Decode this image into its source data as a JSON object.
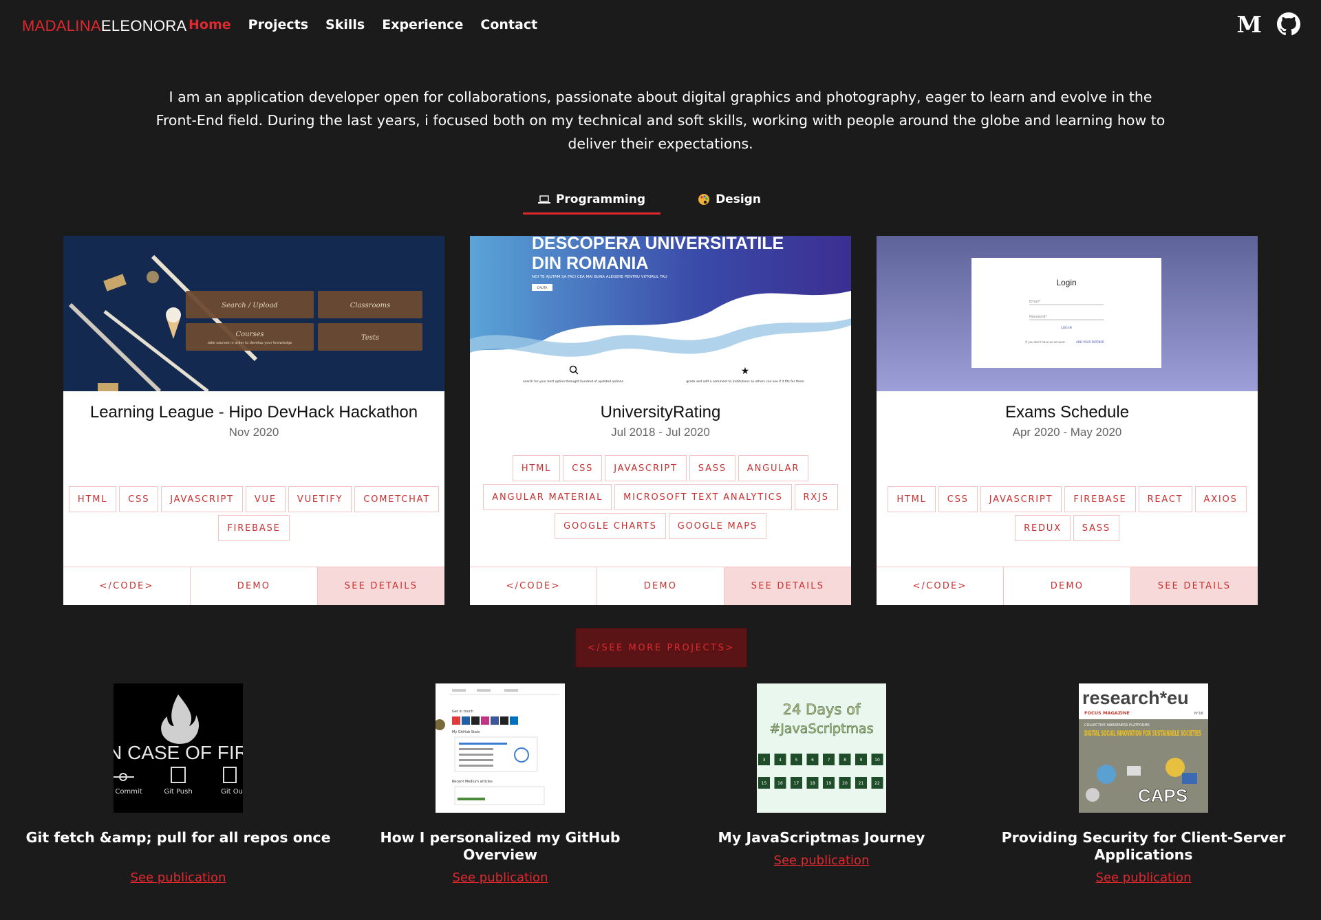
{
  "brand": {
    "first": "MADALINA",
    "second": "ELEONORA"
  },
  "nav": {
    "home": "Home",
    "projects": "Projects",
    "skills": "Skills",
    "experience": "Experience",
    "contact": "Contact"
  },
  "socials": {
    "medium": "M",
    "medium_icon": "medium-icon",
    "github_icon": "github-icon"
  },
  "intro": "I am an application developer open for collaborations, passionate about digital graphics and photography, eager to learn and evolve in the Front-End field. During the last years, i focused both on my technical and soft skills, working with people around the globe and learning how to deliver their expectations.",
  "tabs": [
    {
      "label": "Programming",
      "icon": "laptop-icon",
      "active": true
    },
    {
      "label": "Design",
      "icon": "palette-icon",
      "active": false
    }
  ],
  "projects": [
    {
      "title": "Learning League - Hipo DevHack Hackathon",
      "date": "Nov 2020",
      "tags": [
        "HTML",
        "CSS",
        "JAVASCRIPT",
        "VUE",
        "VUETIFY",
        "COMETCHAT",
        "FIREBASE"
      ],
      "image": {
        "tiles": [
          "Search / Upload",
          "Classrooms",
          "Courses",
          "Tests"
        ],
        "tile_sub": "take courses in order to develop your knowledge"
      }
    },
    {
      "title": "UniversityRating",
      "date": "Jul 2018 - Jul 2020",
      "tags": [
        "HTML",
        "CSS",
        "JAVASCRIPT",
        "SASS",
        "ANGULAR",
        "ANGULAR MATERIAL",
        "MICROSOFT TEXT ANALYTICS",
        "RXJS",
        "GOOGLE CHARTS",
        "GOOGLE MAPS"
      ],
      "image": {
        "headline1": "DESCOPERA UNIVERSITATILE",
        "headline2": "DIN ROMANIA",
        "sub": "NOI TE AJUTAM SA FACI CEA MAI BUNA ALEGERE PENTRU VIITORUL TAU",
        "button": "CAUTA",
        "feat1": "search for your best option throught hundred of updated options",
        "feat2": "grade and add a comment to institutions so others can see if it fits for them"
      }
    },
    {
      "title": "Exams Schedule",
      "date": "Apr 2020 - May 2020",
      "tags": [
        "HTML",
        "CSS",
        "JAVASCRIPT",
        "FIREBASE",
        "REACT",
        "AXIOS",
        "REDUX",
        "SASS"
      ],
      "image": {
        "login_title": "Login",
        "email": "Email*",
        "password": "Password*",
        "login_btn": "LOG IN",
        "no_account": "If you don't have an account",
        "add_partner": "ADD YOUR PARTNER"
      }
    }
  ],
  "card_actions": {
    "code": "</CODE>",
    "demo": "DEMO",
    "details": "SEE DETAILS"
  },
  "see_more": "</SEE MORE PROJECTS>",
  "publications": [
    {
      "title": "Git fetch &amp; pull for all repos once",
      "link": "See publication",
      "thumb": {
        "text": "N CASE OF FIR",
        "labels": [
          "Commit",
          "Git Push",
          "Git Ou"
        ]
      }
    },
    {
      "title": "How I personalized my GitHub Overview",
      "link": "See publication",
      "thumb": {
        "lines": [
          "Get in touch",
          "My GitHub Stats",
          "Recent Medium articles"
        ]
      }
    },
    {
      "title": "My JavaScriptmas Journey",
      "link": "See publication",
      "thumb": {
        "line1": "24 Days of",
        "line2": "#JavaScriptmas",
        "row1": [
          "3",
          "4",
          "5",
          "6",
          "7",
          "8",
          "9",
          "10"
        ],
        "row2": [
          "15",
          "16",
          "17",
          "18",
          "19",
          "20",
          "21",
          "22"
        ]
      }
    },
    {
      "title": "Providing Security for Client-Server Applications",
      "link": "See publication",
      "thumb": {
        "brand": "research*eu",
        "sub": "FOCUS MAGAZINE",
        "issue": "N°16",
        "small": "COLLECTIVE AWARENESS PLATFORMS",
        "headline": "DIGITAL SOCIAL INNOVATION FOR SUSTAINABLE SOCIETIES",
        "caps": "CAPS"
      }
    }
  ],
  "colors": {
    "accent": "#e0282e",
    "background": "#1b1b1c",
    "tag_border": "#f2c4c4",
    "details_bg": "#f7d9da"
  }
}
